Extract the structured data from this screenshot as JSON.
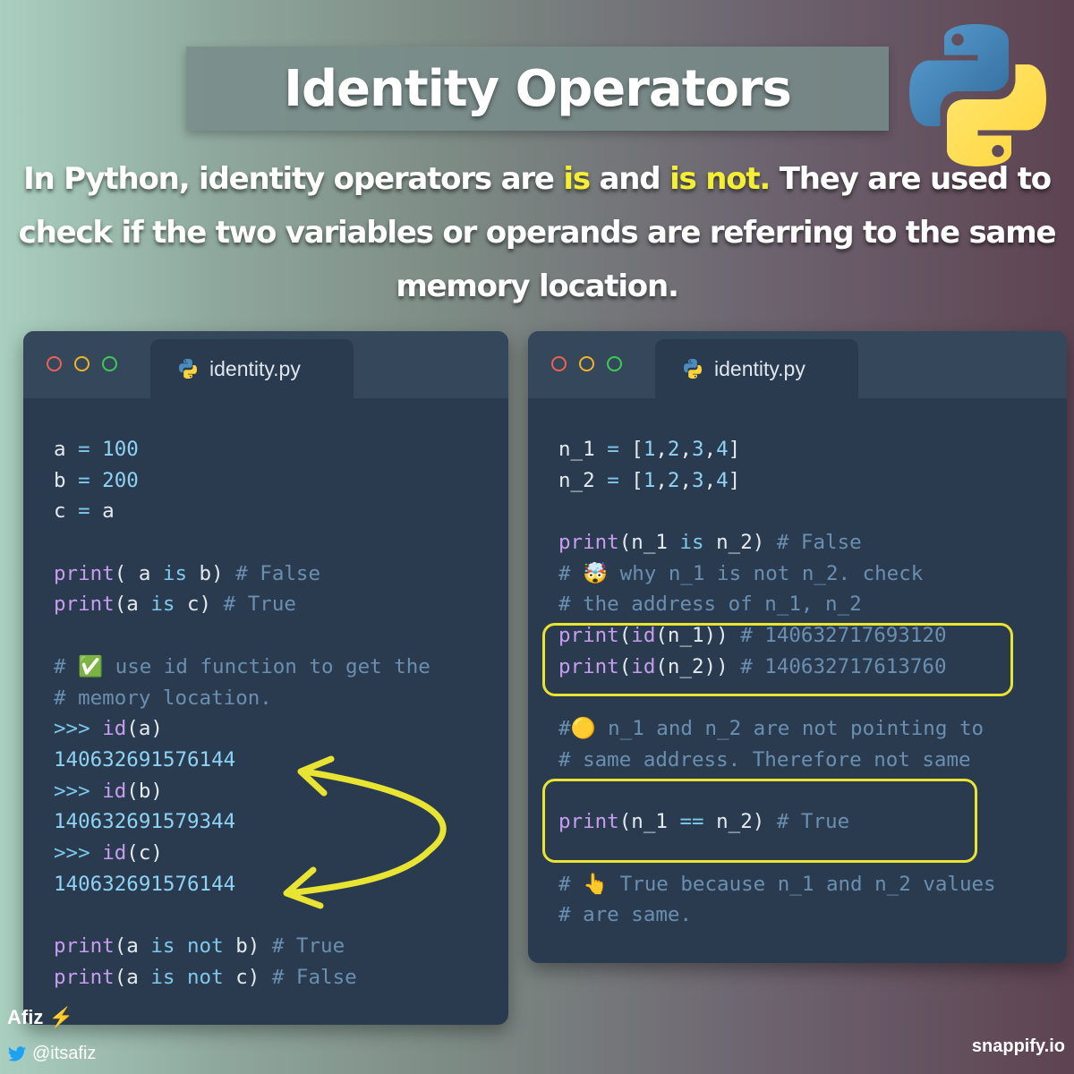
{
  "header": {
    "title": "Identity Operators"
  },
  "intro": {
    "part1": "In Python, identity operators are ",
    "kw1": "is",
    "part2": " and ",
    "kw2": "is not.",
    "part3": " They are used to check if the two variables or operands are referring to the same memory location."
  },
  "left_window": {
    "filename": "identity.py",
    "lines": [
      [
        [
          "id",
          "a "
        ],
        [
          "op",
          "="
        ],
        [
          "num",
          " 100"
        ]
      ],
      [
        [
          "id",
          "b "
        ],
        [
          "op",
          "="
        ],
        [
          "num",
          " 200"
        ]
      ],
      [
        [
          "id",
          "c "
        ],
        [
          "op",
          "="
        ],
        [
          "id",
          " a"
        ]
      ],
      [],
      [
        [
          "kw",
          "print"
        ],
        [
          "id",
          "( a "
        ],
        [
          "op",
          "is"
        ],
        [
          "id",
          " b) "
        ],
        [
          "cm",
          "# False"
        ]
      ],
      [
        [
          "kw",
          "print"
        ],
        [
          "id",
          "(a "
        ],
        [
          "op",
          "is"
        ],
        [
          "id",
          " c) "
        ],
        [
          "cm",
          "# True"
        ]
      ],
      [],
      [
        [
          "cm",
          "# ✅ use id function to get the"
        ]
      ],
      [
        [
          "cm",
          "# memory location."
        ]
      ],
      [
        [
          "op",
          ">>> "
        ],
        [
          "kw",
          "id"
        ],
        [
          "id",
          "(a)"
        ]
      ],
      [
        [
          "num",
          "140632691576144"
        ]
      ],
      [
        [
          "op",
          ">>> "
        ],
        [
          "kw",
          "id"
        ],
        [
          "id",
          "(b)"
        ]
      ],
      [
        [
          "num",
          "140632691579344"
        ]
      ],
      [
        [
          "op",
          ">>> "
        ],
        [
          "kw",
          "id"
        ],
        [
          "id",
          "(c)"
        ]
      ],
      [
        [
          "num",
          "140632691576144"
        ]
      ],
      [],
      [
        [
          "kw",
          "print"
        ],
        [
          "id",
          "(a "
        ],
        [
          "op",
          "is not"
        ],
        [
          "id",
          " b) "
        ],
        [
          "cm",
          "# True"
        ]
      ],
      [
        [
          "kw",
          "print"
        ],
        [
          "id",
          "(a "
        ],
        [
          "op",
          "is not"
        ],
        [
          "id",
          " c) "
        ],
        [
          "cm",
          "# False"
        ]
      ]
    ]
  },
  "right_window": {
    "filename": "identity.py",
    "lines": [
      [
        [
          "id",
          "n_1 "
        ],
        [
          "op",
          "="
        ],
        [
          "id",
          " ["
        ],
        [
          "num",
          "1"
        ],
        [
          "id",
          ","
        ],
        [
          "num",
          "2"
        ],
        [
          "id",
          ","
        ],
        [
          "num",
          "3"
        ],
        [
          "id",
          ","
        ],
        [
          "num",
          "4"
        ],
        [
          "id",
          "]"
        ]
      ],
      [
        [
          "id",
          "n_2 "
        ],
        [
          "op",
          "="
        ],
        [
          "id",
          " ["
        ],
        [
          "num",
          "1"
        ],
        [
          "id",
          ","
        ],
        [
          "num",
          "2"
        ],
        [
          "id",
          ","
        ],
        [
          "num",
          "3"
        ],
        [
          "id",
          ","
        ],
        [
          "num",
          "4"
        ],
        [
          "id",
          "]"
        ]
      ],
      [],
      [
        [
          "kw",
          "print"
        ],
        [
          "id",
          "(n_1 "
        ],
        [
          "op",
          "is"
        ],
        [
          "id",
          " n_2) "
        ],
        [
          "cm",
          "# False"
        ]
      ],
      [
        [
          "cm",
          "# 🤯 why n_1 is not n_2. check"
        ]
      ],
      [
        [
          "cm",
          "# the address of n_1, n_2"
        ]
      ],
      [
        [
          "kw",
          "print"
        ],
        [
          "id",
          "("
        ],
        [
          "kw",
          "id"
        ],
        [
          "id",
          "(n_1)) "
        ],
        [
          "cm",
          "# 140632717693120"
        ]
      ],
      [
        [
          "kw",
          "print"
        ],
        [
          "id",
          "("
        ],
        [
          "kw",
          "id"
        ],
        [
          "id",
          "(n_2)) "
        ],
        [
          "cm",
          "# 140632717613760"
        ]
      ],
      [],
      [
        [
          "cm",
          "#🟡 n_1 and n_2 are not pointing to"
        ]
      ],
      [
        [
          "cm",
          "# same address. Therefore not same"
        ]
      ],
      [],
      [
        [
          "kw",
          "print"
        ],
        [
          "id",
          "(n_1 "
        ],
        [
          "op",
          "=="
        ],
        [
          "id",
          " n_2) "
        ],
        [
          "cm",
          "# True"
        ]
      ],
      [],
      [
        [
          "cm",
          "# 👆 True because n_1 and n_2 values"
        ]
      ],
      [
        [
          "cm",
          "# are same."
        ]
      ]
    ]
  },
  "footer": {
    "author": "Afiz ⚡",
    "handle": "@itsafiz",
    "brand": "snappify.io"
  },
  "colors": {
    "highlight": "#f4ee34",
    "window_bg": "#2a3b4f",
    "keyword": "#c79df0",
    "operator": "#7ec9ec",
    "comment": "#6b8fb0"
  },
  "icons": [
    "python-logo-icon",
    "python-file-icon",
    "twitter-bird-icon",
    "curved-double-arrow"
  ]
}
